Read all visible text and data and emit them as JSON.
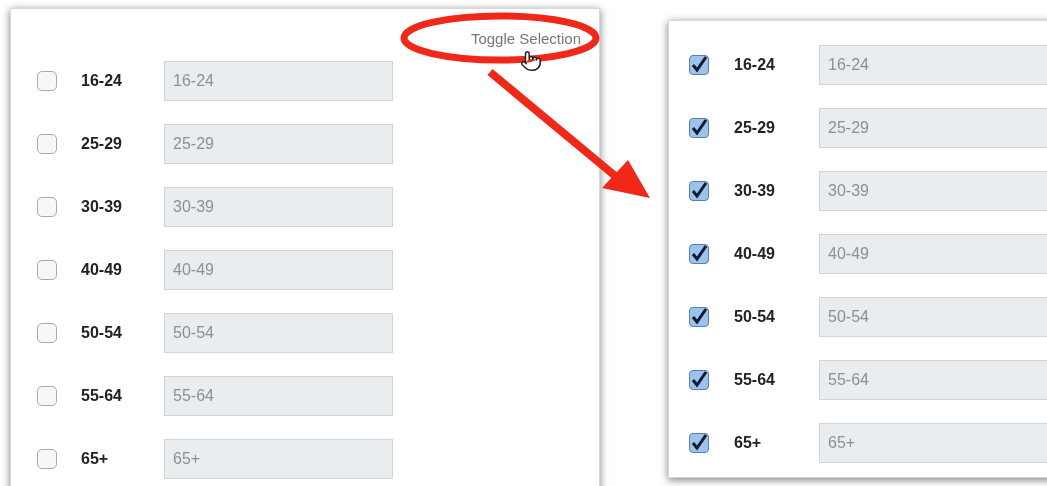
{
  "panels": [
    {
      "toggle_link": {
        "label": "Toggle Selection"
      },
      "rows": [
        {
          "label": "16-24",
          "placeholder": "16-24",
          "checked": false
        },
        {
          "label": "25-29",
          "placeholder": "25-29",
          "checked": false
        },
        {
          "label": "30-39",
          "placeholder": "30-39",
          "checked": false
        },
        {
          "label": "40-49",
          "placeholder": "40-49",
          "checked": false
        },
        {
          "label": "50-54",
          "placeholder": "50-54",
          "checked": false
        },
        {
          "label": "55-64",
          "placeholder": "55-64",
          "checked": false
        },
        {
          "label": "65+",
          "placeholder": "65+",
          "checked": false
        }
      ]
    },
    {
      "rows": [
        {
          "label": "16-24",
          "placeholder": "16-24",
          "checked": true
        },
        {
          "label": "25-29",
          "placeholder": "25-29",
          "checked": true
        },
        {
          "label": "30-39",
          "placeholder": "30-39",
          "checked": true
        },
        {
          "label": "40-49",
          "placeholder": "40-49",
          "checked": true
        },
        {
          "label": "50-54",
          "placeholder": "50-54",
          "checked": true
        },
        {
          "label": "55-64",
          "placeholder": "55-64",
          "checked": true
        },
        {
          "label": "65+",
          "placeholder": "65+",
          "checked": true
        }
      ]
    }
  ]
}
